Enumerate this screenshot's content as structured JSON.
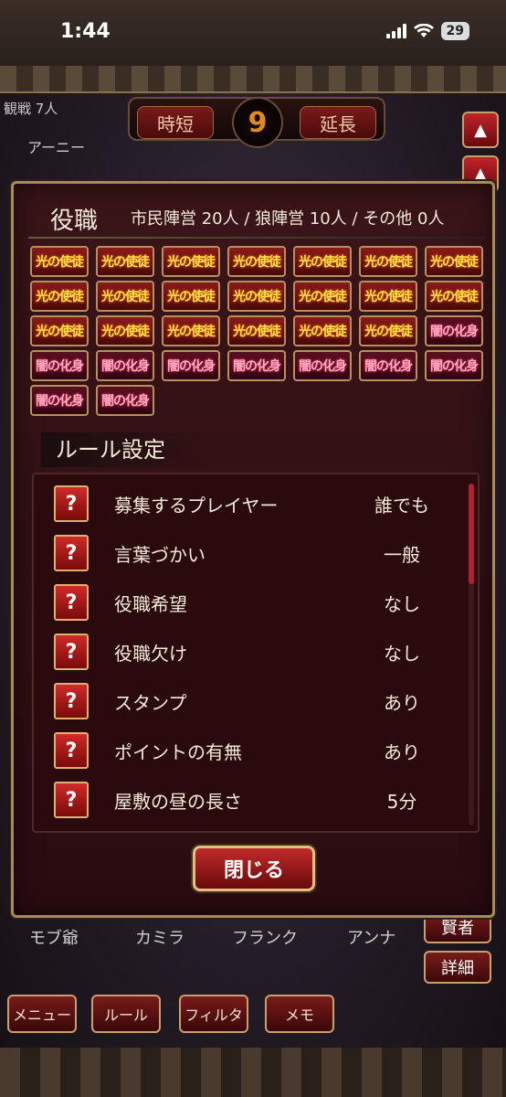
{
  "status_bar": {
    "time": "1:44",
    "battery": "29"
  },
  "game": {
    "spectate": "観戦 7人",
    "timer_short": "時短",
    "timer_extend": "延長",
    "day": "9",
    "player_top": "アーニー",
    "bottom_names": [
      "モブ爺",
      "カミラ",
      "フランク",
      "アンナ"
    ],
    "side_btn_sage": "賢者",
    "side_btn_detail": "詳細",
    "menu": [
      "メニュー",
      "ルール",
      "フィルタ",
      "メモ"
    ]
  },
  "modal": {
    "title": "役職",
    "summary": "市民陣営 20人 / 狼陣営 10人 / その他 0人",
    "roles": [
      "光の使徒",
      "光の使徒",
      "光の使徒",
      "光の使徒",
      "光の使徒",
      "光の使徒",
      "光の使徒",
      "光の使徒",
      "光の使徒",
      "光の使徒",
      "光の使徒",
      "光の使徒",
      "光の使徒",
      "光の使徒",
      "光の使徒",
      "光の使徒",
      "光の使徒",
      "光の使徒",
      "光の使徒",
      "光の使徒",
      "闇の化身",
      "闇の化身",
      "闇の化身",
      "闇の化身",
      "闇の化身",
      "闇の化身",
      "闇の化身",
      "闇の化身",
      "闇の化身",
      "闇の化身"
    ],
    "rule_title": "ルール設定",
    "rules": [
      {
        "label": "募集するプレイヤー",
        "value": "誰でも"
      },
      {
        "label": "言葉づかい",
        "value": "一般"
      },
      {
        "label": "役職希望",
        "value": "なし"
      },
      {
        "label": "役職欠け",
        "value": "なし"
      },
      {
        "label": "スタンプ",
        "value": "あり"
      },
      {
        "label": "ポイントの有無",
        "value": "あり"
      },
      {
        "label": "屋敷の昼の長さ",
        "value": "5分"
      }
    ],
    "help_symbol": "?",
    "close_label": "閉じる"
  }
}
